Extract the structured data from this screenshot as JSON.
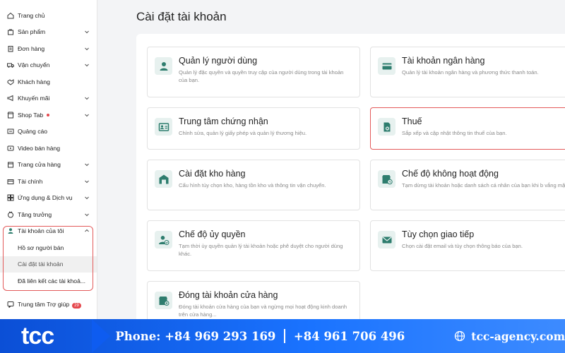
{
  "sidebar": {
    "items": [
      {
        "label": "Trang chủ",
        "icon": "home-icon",
        "chevron": false
      },
      {
        "label": "Sản phẩm",
        "icon": "bag-icon",
        "chevron": true
      },
      {
        "label": "Đơn hàng",
        "icon": "clipboard-icon",
        "chevron": true
      },
      {
        "label": "Vận chuyển",
        "icon": "truck-icon",
        "chevron": true
      },
      {
        "label": "Khách hàng",
        "icon": "handshake-icon",
        "chevron": false
      },
      {
        "label": "Khuyến mãi",
        "icon": "megaphone-icon",
        "chevron": true
      },
      {
        "label": "Shop Tab",
        "icon": "shop-icon",
        "chevron": true,
        "dot": true
      },
      {
        "label": "Quảng cáo",
        "icon": "ads-icon",
        "chevron": false
      },
      {
        "label": "Video bán hàng",
        "icon": "video-icon",
        "chevron": false
      },
      {
        "label": "Trang cửa hàng",
        "icon": "store-icon",
        "chevron": true
      },
      {
        "label": "Tài chính",
        "icon": "wallet-icon",
        "chevron": true
      },
      {
        "label": "Ứng dụng & Dịch vụ",
        "icon": "apps-icon",
        "chevron": true
      },
      {
        "label": "Tăng trưởng",
        "icon": "growth-icon",
        "chevron": true
      }
    ],
    "account": {
      "label": "Tài khoản của tôi",
      "sub": [
        "Hồ sơ người bán",
        "Cài đặt tài khoản",
        "Đã liên kết các tài khoả..."
      ]
    },
    "help": {
      "label": "Trung tâm Trợ giúp",
      "badge": "29"
    }
  },
  "main": {
    "title": "Cài đặt tài khoản",
    "cards": [
      {
        "title": "Quản lý người dùng",
        "desc": "Quản lý đặc quyền và quyền truy cập của người dùng trong tài khoản của bạn."
      },
      {
        "title": "Tài khoản ngân hàng",
        "desc": "Quản lý tài khoản ngân hàng và phương thức thanh toán."
      },
      {
        "title": "Trung tâm chứng nhận",
        "desc": "Chỉnh sửa, quản lý giấy phép và quản lý thương hiệu."
      },
      {
        "title": "Thuế",
        "desc": "Sắp xếp và cập nhật thông tin thuế của bạn."
      },
      {
        "title": "Cài đặt kho hàng",
        "desc": "Cấu hình tùy chọn kho, hàng tồn kho và thông tin vận chuyển."
      },
      {
        "title": "Chế độ không hoạt động",
        "desc": "Tạm dừng tài khoản hoặc danh sách cá nhân của bạn khi b vắng mặt."
      },
      {
        "title": "Chế độ ủy quyền",
        "desc": "Tạm thời ủy quyền quản lý tài khoản hoặc phê duyệt cho người dùng khác."
      },
      {
        "title": "Tùy chọn giao tiếp",
        "desc": "Chọn cài đặt email và tùy chọn thông báo của bạn."
      },
      {
        "title": "Đóng tài khoản cửa hàng",
        "desc": "Đóng tài khoản cửa hàng của bạn và ngừng mọi hoạt động kinh doanh trên cửa hàng..."
      }
    ]
  },
  "footer": {
    "logo": "tcc",
    "phone1": "Phone: +84 969 293 169",
    "phone2": "+84 961 706 496",
    "site": "tcc-agency.com"
  },
  "colors": {
    "accent": "#2e7d6e",
    "highlight": "#e35a5a",
    "banner": "#1a73ff"
  }
}
